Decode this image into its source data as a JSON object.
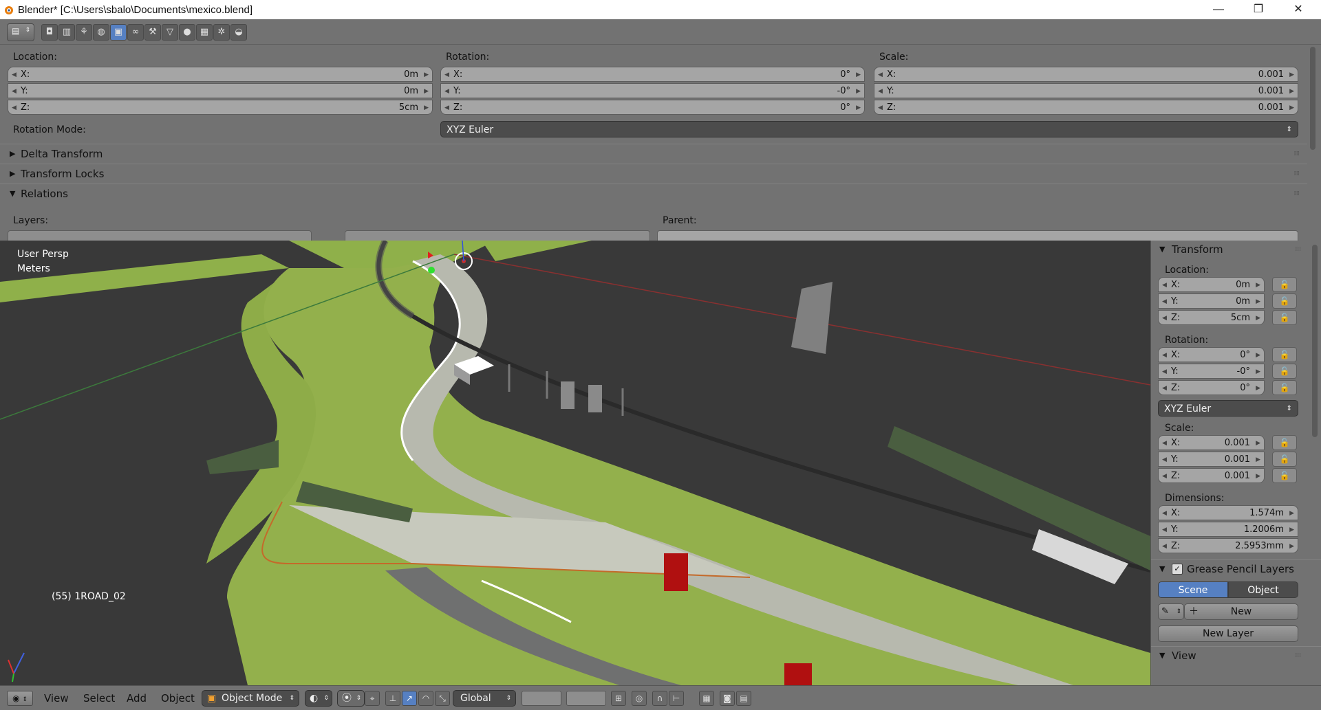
{
  "window": {
    "title": "Blender* [C:\\Users\\sbalo\\Documents\\mexico.blend]",
    "minimize": "—",
    "maximize": "❐",
    "close": "✕"
  },
  "properties": {
    "location_label": "Location:",
    "rotation_label": "Rotation:",
    "scale_label": "Scale:",
    "location": [
      {
        "k": "X:",
        "v": "0m"
      },
      {
        "k": "Y:",
        "v": "0m"
      },
      {
        "k": "Z:",
        "v": "5cm"
      }
    ],
    "rotation": [
      {
        "k": "X:",
        "v": "0°"
      },
      {
        "k": "Y:",
        "v": "-0°"
      },
      {
        "k": "Z:",
        "v": "0°"
      }
    ],
    "scale": [
      {
        "k": "X:",
        "v": "0.001"
      },
      {
        "k": "Y:",
        "v": "0.001"
      },
      {
        "k": "Z:",
        "v": "0.001"
      }
    ],
    "rotation_mode_label": "Rotation Mode:",
    "rotation_mode_value": "XYZ Euler",
    "panels": {
      "delta": "Delta Transform",
      "locks": "Transform Locks",
      "relations": "Relations"
    },
    "layers_label": "Layers:",
    "parent_label": "Parent:"
  },
  "viewport": {
    "view_name": "User Persp",
    "units": "Meters",
    "object_info": "(55) 1ROAD_02"
  },
  "npanel": {
    "transform_title": "Transform",
    "location_label": "Location:",
    "location": [
      {
        "k": "X:",
        "v": "0m"
      },
      {
        "k": "Y:",
        "v": "0m"
      },
      {
        "k": "Z:",
        "v": "5cm"
      }
    ],
    "rotation_label": "Rotation:",
    "rotation": [
      {
        "k": "X:",
        "v": "0°"
      },
      {
        "k": "Y:",
        "v": "-0°"
      },
      {
        "k": "Z:",
        "v": "0°"
      }
    ],
    "rotation_mode_value": "XYZ Euler",
    "scale_label": "Scale:",
    "scale": [
      {
        "k": "X:",
        "v": "0.001"
      },
      {
        "k": "Y:",
        "v": "0.001"
      },
      {
        "k": "Z:",
        "v": "0.001"
      }
    ],
    "dimensions_label": "Dimensions:",
    "dimensions": [
      {
        "k": "X:",
        "v": "1.574m"
      },
      {
        "k": "Y:",
        "v": "1.2006m"
      },
      {
        "k": "Z:",
        "v": "2.5953mm"
      }
    ],
    "grease_title": "Grease Pencil Layers",
    "scene_tab": "Scene",
    "object_tab": "Object",
    "new_button": "New",
    "new_layer_button": "New Layer",
    "view_title": "View"
  },
  "bottombar": {
    "view": "View",
    "select": "Select",
    "add": "Add",
    "object": "Object",
    "mode": "Object Mode",
    "orientation": "Global"
  }
}
